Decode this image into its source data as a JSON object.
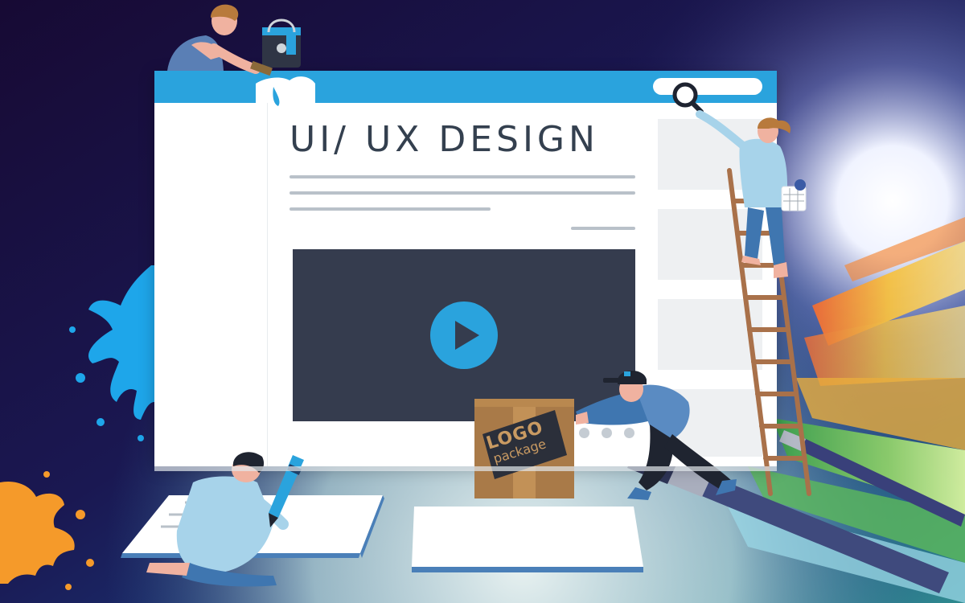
{
  "title": "UI/ UX DESIGN",
  "box_label": {
    "main": "LOGO",
    "sub": "package"
  },
  "search": {
    "icon": "magnifier-icon"
  },
  "video": {
    "icon": "play-icon"
  },
  "colors": {
    "accent": "#2aa3dd",
    "video_bg": "#353c4e",
    "title_text": "#34404f",
    "box": "#a97a48",
    "ladder": "#a9714a",
    "splash_blue": "#1ea6ea",
    "splash_orange": "#f59a2a"
  }
}
